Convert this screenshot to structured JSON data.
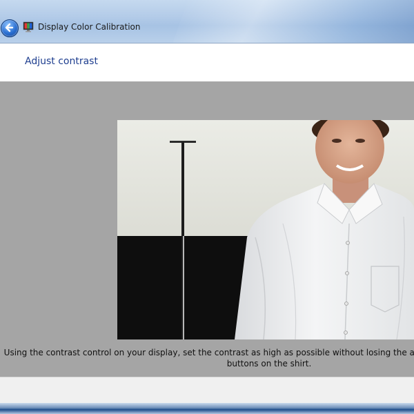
{
  "window": {
    "title": "Display Color Calibration",
    "icon": "display-monitor-icon",
    "back_icon": "back-arrow-icon"
  },
  "header": {
    "heading": "Adjust contrast"
  },
  "main": {
    "image_subject": "man-in-white-shirt-calibration-photo",
    "instruction": "Using the contrast control on your display, set the contrast as high as possible without losing the ability to see the wrinkles and buttons on the shirt."
  },
  "colors": {
    "heading": "#1e3e8f",
    "content_background": "#a5a5a5",
    "footer_background": "#f0f0f0"
  }
}
